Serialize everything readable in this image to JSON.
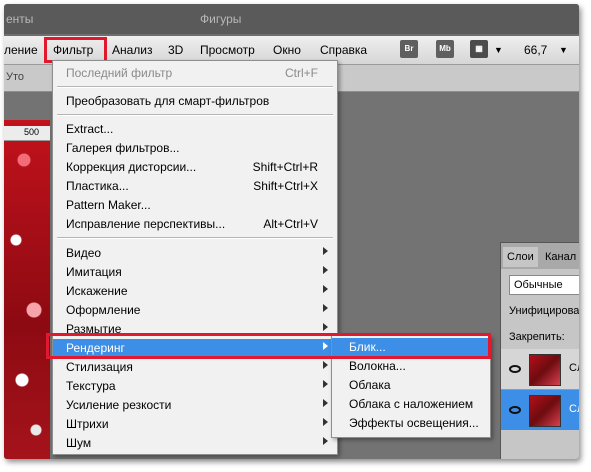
{
  "panel_title": {
    "left": "енты",
    "right": "Фигуры"
  },
  "menubar": {
    "items": [
      "ление",
      "Фильтр",
      "Анализ",
      "3D",
      "Просмотр",
      "Окно",
      "Справка"
    ],
    "br_button": "Br",
    "mb_button": "Mb",
    "zoom": "66,7"
  },
  "options_bar": {
    "label": "Уто"
  },
  "ruler": {
    "value": "500"
  },
  "filter_menu": {
    "items": [
      {
        "label": "Последний фильтр",
        "shortcut": "Ctrl+F"
      },
      {
        "label": "Преобразовать для смарт-фильтров"
      },
      {
        "label": "Extract..."
      },
      {
        "label": "Галерея фильтров..."
      },
      {
        "label": "Коррекция дисторсии...",
        "shortcut": "Shift+Ctrl+R"
      },
      {
        "label": "Пластика...",
        "shortcut": "Shift+Ctrl+X"
      },
      {
        "label": "Pattern Maker..."
      },
      {
        "label": "Исправление перспективы...",
        "shortcut": "Alt+Ctrl+V"
      },
      {
        "label": "Видео"
      },
      {
        "label": "Имитация"
      },
      {
        "label": "Искажение"
      },
      {
        "label": "Оформление"
      },
      {
        "label": "Размытие"
      },
      {
        "label": "Рендеринг"
      },
      {
        "label": "Стилизация"
      },
      {
        "label": "Текстура"
      },
      {
        "label": "Усиление резкости"
      },
      {
        "label": "Штрихи"
      },
      {
        "label": "Шум"
      }
    ]
  },
  "render_submenu": {
    "items": [
      "Блик...",
      "Волокна...",
      "Облака",
      "Облака с наложением",
      "Эффекты освещения..."
    ]
  },
  "layers_panel": {
    "tab_layers": "Слои",
    "tab_channels": "Канал",
    "blend_mode": "Обычные",
    "unify": "Унифицироват",
    "lock": "Закрепить:",
    "layer1": "Сл",
    "layer2": "Сл"
  },
  "colors": {
    "highlight": "#3d8ee6",
    "callout": "#e0192e"
  }
}
